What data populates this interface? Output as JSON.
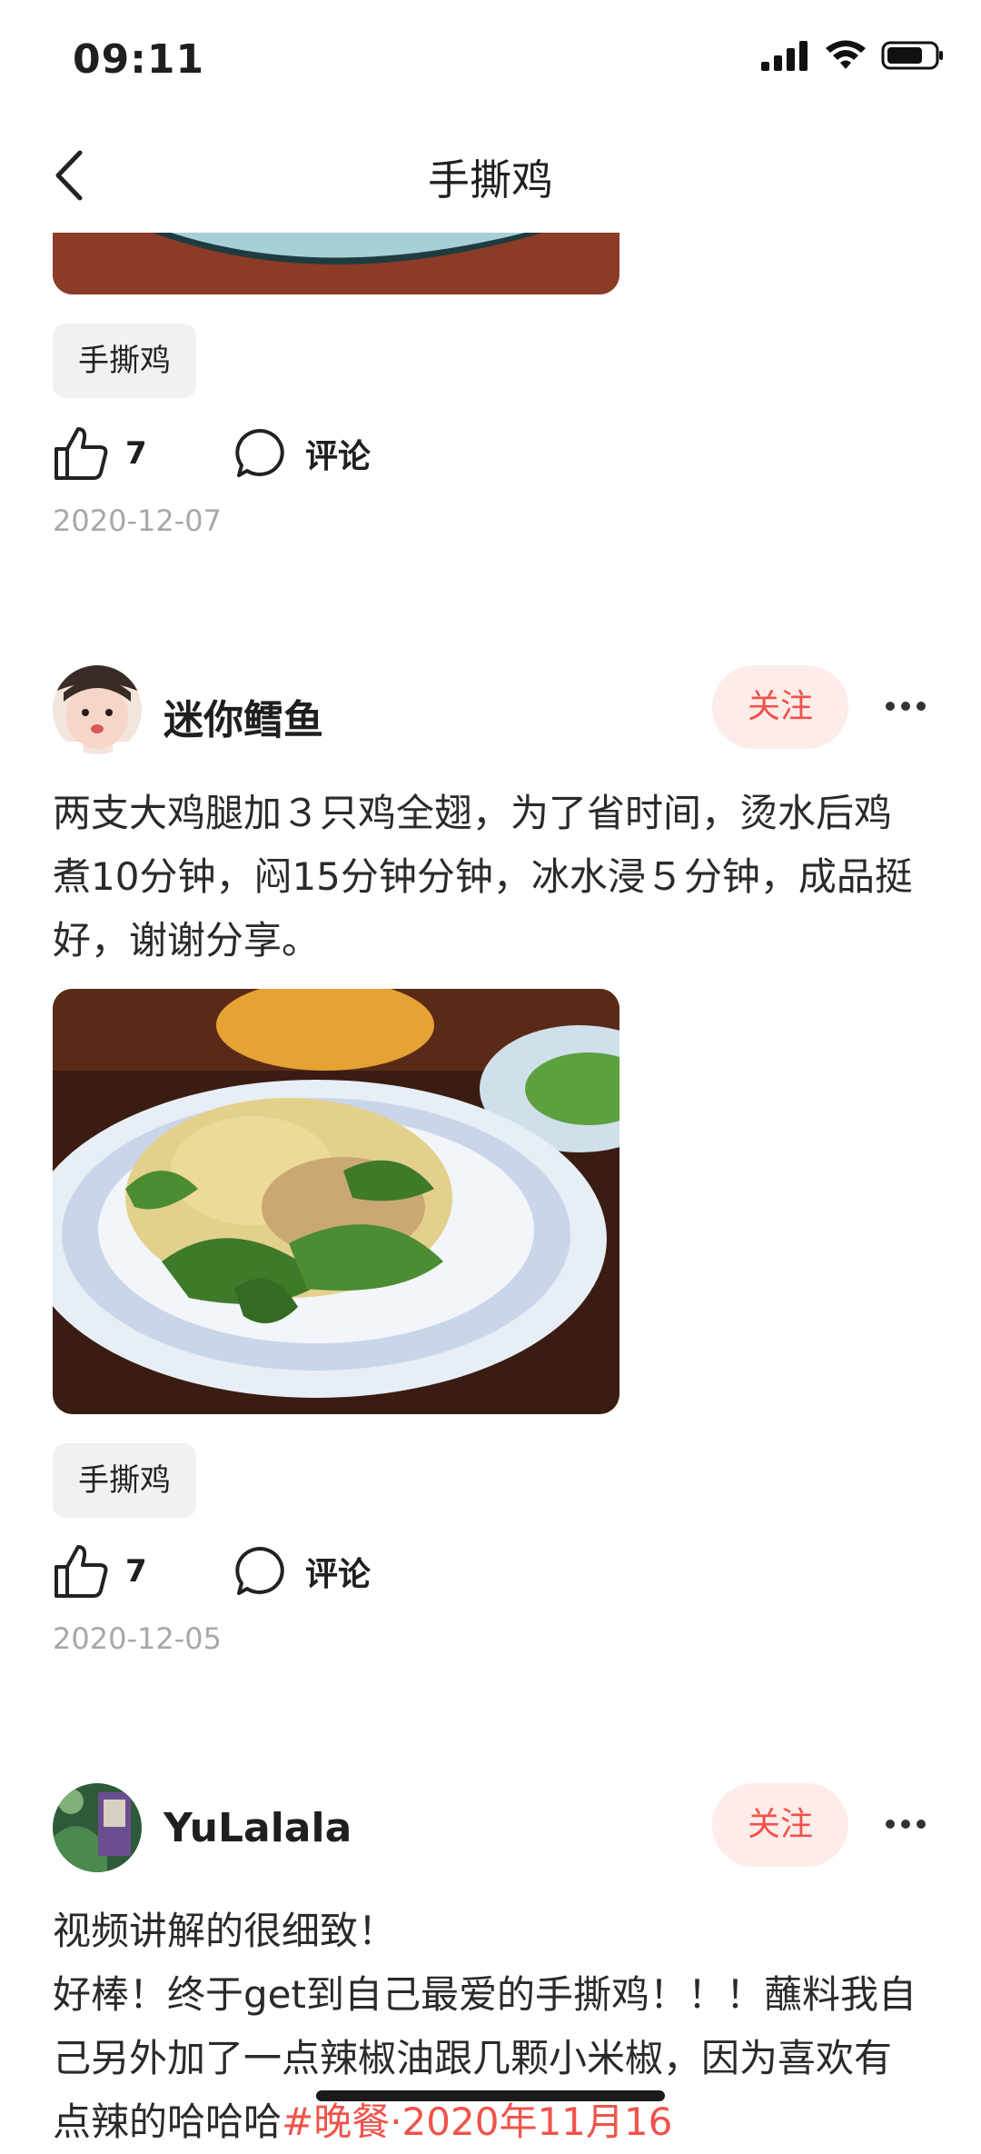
{
  "status": {
    "time": "09:11"
  },
  "nav": {
    "title": "手撕鸡"
  },
  "posts": [
    {
      "tag": "手撕鸡",
      "likes": "7",
      "comment_label": "评论",
      "date": "2020-12-07"
    },
    {
      "author": "迷你鳕鱼",
      "follow_label": "关注",
      "text": "两支大鸡腿加３只鸡全翅，为了省时间，烫水后鸡煮10分钟，闷15分钟分钟，冰水浸５分钟，成品挺好，谢谢分享。",
      "tag": "手撕鸡",
      "likes": "7",
      "comment_label": "评论",
      "date": "2020-12-05"
    },
    {
      "author": "YuLalala",
      "follow_label": "关注",
      "text_line1": "视频讲解的很细致！",
      "text_line2": "好棒！终于get到自己最爱的手撕鸡！！！蘸料我自己另外加了一点辣椒油跟几颗小米椒，因为喜欢有点辣的哈哈哈",
      "hashtag": "#晚餐·2020年11月16"
    }
  ],
  "colors": {
    "accent": "#f0534a",
    "follow_bg": "#fdecea",
    "tag_bg": "#f1f1f1",
    "date": "#a8a8a8"
  }
}
